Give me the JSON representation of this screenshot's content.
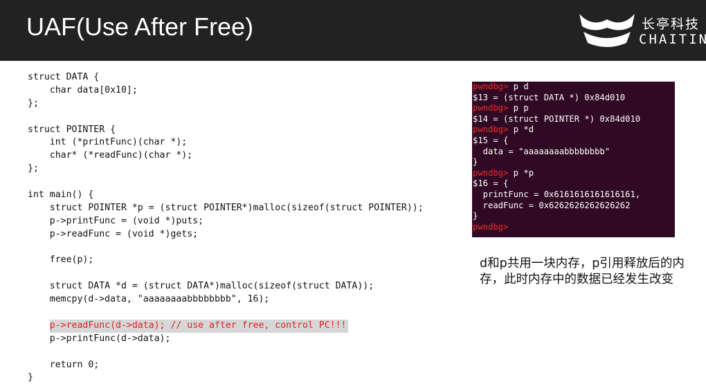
{
  "slide": {
    "title": "UAF(Use After Free)",
    "logo": {
      "cn": "长亭科技",
      "en": "CHAITIN"
    }
  },
  "code": {
    "lines": [
      "struct DATA {",
      "    char data[0x10];",
      "};",
      "",
      "struct POINTER {",
      "    int (*printFunc)(char *);",
      "    char* (*readFunc)(char *);",
      "};",
      "",
      "int main() {",
      "    struct POINTER *p = (struct POINTER*)malloc(sizeof(struct POINTER));",
      "    p->printFunc = (void *)puts;",
      "    p->readFunc = (void *)gets;",
      "",
      "    free(p);",
      "",
      "    struct DATA *d = (struct DATA*)malloc(sizeof(struct DATA));",
      "    memcpy(d->data, \"aaaaaaaabbbbbbbb\", 16);",
      "",
      "    ",
      "    p->printFunc(d->data);",
      "",
      "    return 0;",
      "}"
    ],
    "highlight_indent": "    ",
    "highlight_text": "p->readFunc(d->data); // use after free, control PC!!!"
  },
  "terminal": {
    "prompt": "pwndbg>",
    "lines": [
      {
        "prompt": "pwndbg>",
        "text": " p d"
      },
      {
        "prompt": "",
        "text": "$13 = (struct DATA *) 0x84d010"
      },
      {
        "prompt": "pwndbg>",
        "text": " p p"
      },
      {
        "prompt": "",
        "text": "$14 = (struct POINTER *) 0x84d010"
      },
      {
        "prompt": "pwndbg>",
        "text": " p *d"
      },
      {
        "prompt": "",
        "text": "$15 = {"
      },
      {
        "prompt": "",
        "text": "  data = \"aaaaaaaabbbbbbbb\""
      },
      {
        "prompt": "",
        "text": "}"
      },
      {
        "prompt": "pwndbg>",
        "text": " p *p"
      },
      {
        "prompt": "",
        "text": "$16 = {"
      },
      {
        "prompt": "",
        "text": "  printFunc = 0x6161616161616161,"
      },
      {
        "prompt": "",
        "text": "  readFunc = 0x6262626262626262"
      },
      {
        "prompt": "",
        "text": "}"
      },
      {
        "prompt": "pwndbg>",
        "text": ""
      }
    ]
  },
  "note": {
    "text": "d和p共用一块内存，p引用释放后的内存，此时内存中的数据已经发生改变"
  },
  "colors": {
    "header_bg": "#222222",
    "terminal_bg": "#300a24",
    "prompt": "#ef2929",
    "highlight_text": "#e02020",
    "highlight_bg": "#d6d6d6"
  }
}
